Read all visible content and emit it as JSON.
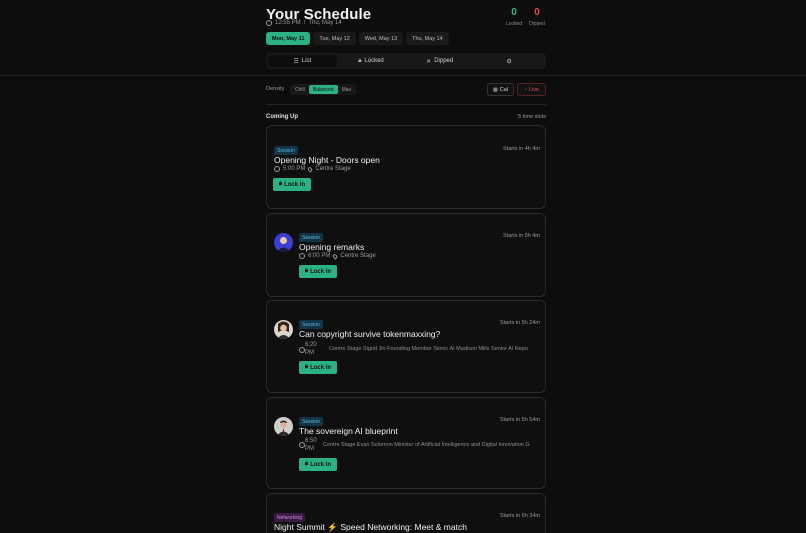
{
  "header": {
    "title": "Your Schedule",
    "time": "12:55 PM",
    "separator": "/",
    "date": "Thu, May 14",
    "locked_count": "0",
    "locked_label": "Locked",
    "dipped_count": "0",
    "dipped_label": "Dipped"
  },
  "days": [
    {
      "label": "Mon, May 11",
      "active": true
    },
    {
      "label": "Tue, May 12",
      "active": false
    },
    {
      "label": "Wed, May 13",
      "active": false
    },
    {
      "label": "Thu, May 14",
      "active": false
    }
  ],
  "views": {
    "list": "List",
    "locked": "Locked",
    "dipped": "Dipped"
  },
  "density": {
    "label": "Density",
    "options": [
      "Chill",
      "Balanced",
      "Max"
    ],
    "selected": "Balanced"
  },
  "actions": {
    "cal": "Cal",
    "live": "Live"
  },
  "section": {
    "title": "Coming Up",
    "slots": "5 time slots"
  },
  "colors": {
    "accent": "#2bb184",
    "danger": "#e5484d",
    "session_badge": "#5fb7e6",
    "networking_badge": "#d18ae0"
  },
  "cards": [
    {
      "badge": "Session",
      "title": "Opening Night - Doors open",
      "time": "5:00 PM",
      "venue": "Centre Stage",
      "starts": "Starts in 4h 4m",
      "lock": "Lock in"
    },
    {
      "badge": "Session",
      "title": "Opening remarks",
      "time": "6:00 PM",
      "venue": "Centre Stage",
      "starts": "Starts in 5h 4m",
      "lock": "Lock in"
    },
    {
      "badge": "Session",
      "title": "Can copyright survive tokenmaxxing?",
      "time_a": "6:20",
      "time_b": "PM",
      "venue_long": "Centre Stage Sigrid Jin Founding Member Sionic AI Madison Mills Senior AI Repo",
      "starts": "Starts in 5h 24m",
      "lock": "Lock in"
    },
    {
      "badge": "Session",
      "title": "The sovereign AI blueprint",
      "time_a": "6:50",
      "time_b": "PM",
      "venue_long": "Centre Stage Evan Solomon Minister of Artificial Intelligence and Digital Innovation G",
      "starts": "Starts in 5h 54m",
      "lock": "Lock in"
    },
    {
      "badge": "Networking",
      "title": "Night Summit ⚡ Speed Networking: Meet & match",
      "starts": "Starts in 6h 34m"
    }
  ]
}
